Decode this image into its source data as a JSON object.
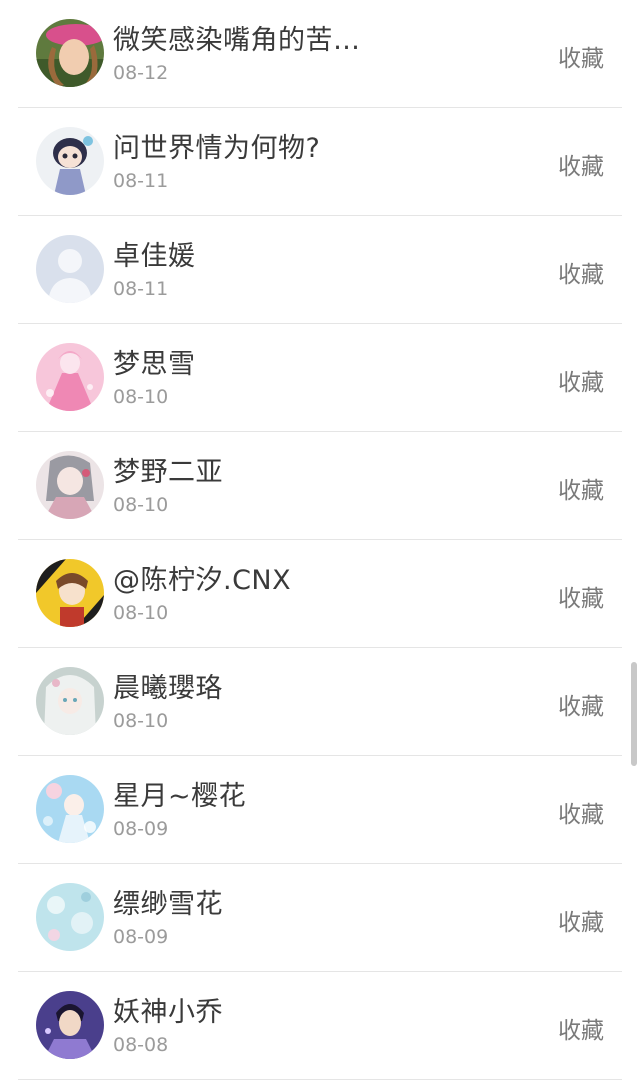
{
  "users": [
    {
      "name": "微笑感染嘴角的苦…",
      "date": "08-12",
      "action": "收藏",
      "avatar": "avatar-girl-pink-hat"
    },
    {
      "name": "问世界情为何物?",
      "date": "08-11",
      "action": "收藏",
      "avatar": "avatar-cartoon-doll"
    },
    {
      "name": "卓佳媛",
      "date": "08-11",
      "action": "收藏",
      "avatar": "avatar-default-silhouette"
    },
    {
      "name": "梦思雪",
      "date": "08-10",
      "action": "收藏",
      "avatar": "avatar-pink-dress"
    },
    {
      "name": "梦野二亚",
      "date": "08-10",
      "action": "收藏",
      "avatar": "avatar-anime-girl-gray"
    },
    {
      "name": "@陈柠汐.CNX",
      "date": "08-10",
      "action": "收藏",
      "avatar": "avatar-yellow-black-anime"
    },
    {
      "name": "晨曦瓔珞",
      "date": "08-10",
      "action": "收藏",
      "avatar": "avatar-white-hair-anime"
    },
    {
      "name": "星月~樱花",
      "date": "08-09",
      "action": "收藏",
      "avatar": "avatar-blue-fairy"
    },
    {
      "name": "缥缈雪花",
      "date": "08-09",
      "action": "收藏",
      "avatar": "avatar-light-blue-flowers"
    },
    {
      "name": "妖神小乔",
      "date": "08-08",
      "action": "收藏",
      "avatar": "avatar-purple-costume-man"
    }
  ]
}
